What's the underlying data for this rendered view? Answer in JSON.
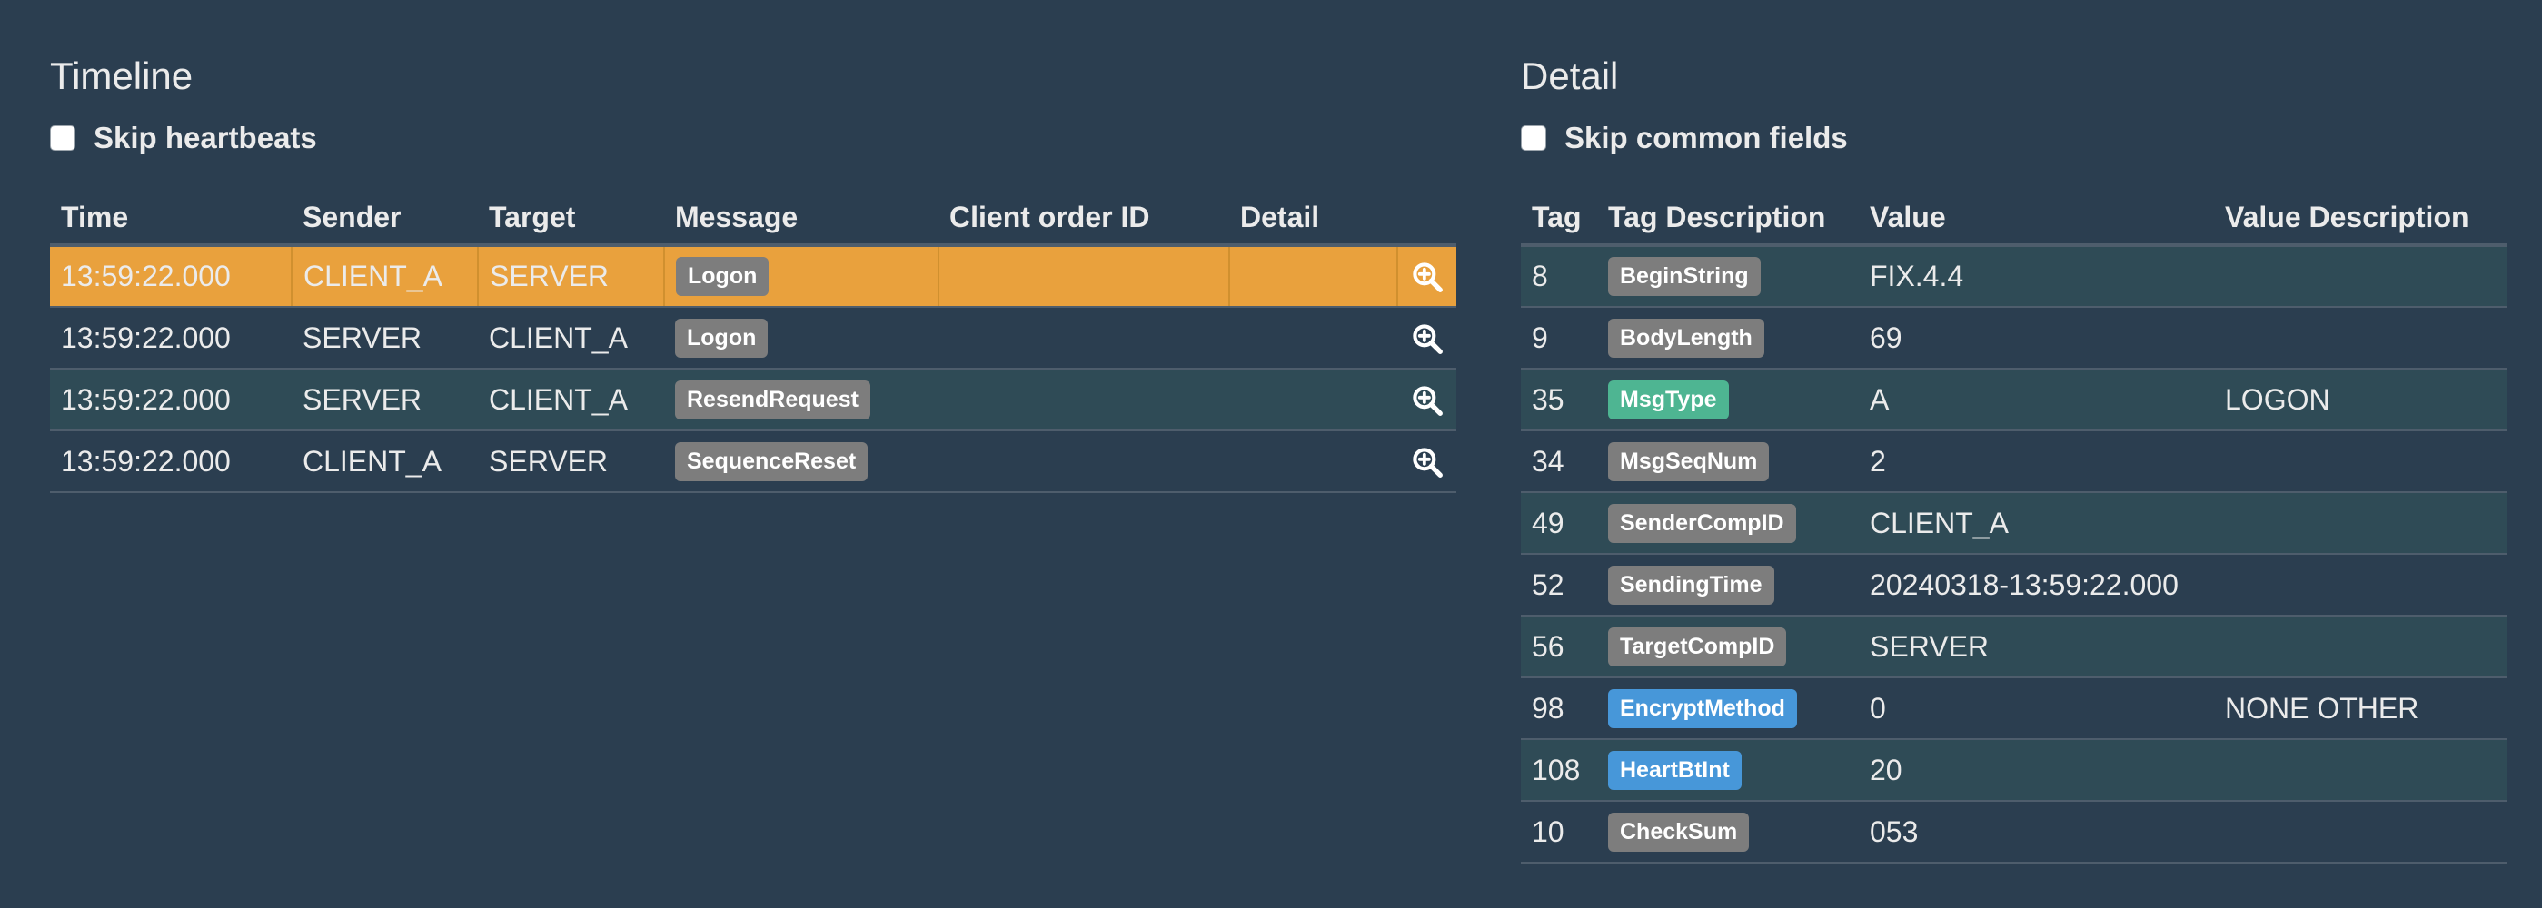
{
  "timeline": {
    "title": "Timeline",
    "skip_label": "Skip heartbeats",
    "columns": [
      "Time",
      "Sender",
      "Target",
      "Message",
      "Client order ID",
      "Detail"
    ],
    "rows": [
      {
        "time": "13:59:22.000",
        "sender": "CLIENT_A",
        "target": "SERVER",
        "message": "Logon",
        "client_order_id": "",
        "selected": true
      },
      {
        "time": "13:59:22.000",
        "sender": "SERVER",
        "target": "CLIENT_A",
        "message": "Logon",
        "client_order_id": ""
      },
      {
        "time": "13:59:22.000",
        "sender": "SERVER",
        "target": "CLIENT_A",
        "message": "ResendRequest",
        "client_order_id": ""
      },
      {
        "time": "13:59:22.000",
        "sender": "CLIENT_A",
        "target": "SERVER",
        "message": "SequenceReset",
        "client_order_id": ""
      }
    ],
    "detail_icon": "zoom-in-icon",
    "selected_color": "#e9a13d"
  },
  "detail": {
    "title": "Detail",
    "skip_label": "Skip common fields",
    "columns": [
      "Tag",
      "Tag Description",
      "Value",
      "Value Description"
    ],
    "rows": [
      {
        "tag": "8",
        "description": "BeginString",
        "style": "default",
        "value": "FIX.4.4",
        "value_description": ""
      },
      {
        "tag": "9",
        "description": "BodyLength",
        "style": "default",
        "value": "69",
        "value_description": ""
      },
      {
        "tag": "35",
        "description": "MsgType",
        "style": "success",
        "value": "A",
        "value_description": "LOGON"
      },
      {
        "tag": "34",
        "description": "MsgSeqNum",
        "style": "default",
        "value": "2",
        "value_description": ""
      },
      {
        "tag": "49",
        "description": "SenderCompID",
        "style": "default",
        "value": "CLIENT_A",
        "value_description": ""
      },
      {
        "tag": "52",
        "description": "SendingTime",
        "style": "default",
        "value": "20240318-13:59:22.000",
        "value_description": ""
      },
      {
        "tag": "56",
        "description": "TargetCompID",
        "style": "default",
        "value": "SERVER",
        "value_description": ""
      },
      {
        "tag": "98",
        "description": "EncryptMethod",
        "style": "info",
        "value": "0",
        "value_description": "NONE OTHER"
      },
      {
        "tag": "108",
        "description": "HeartBtInt",
        "style": "info",
        "value": "20",
        "value_description": ""
      },
      {
        "tag": "10",
        "description": "CheckSum",
        "style": "default",
        "value": "053",
        "value_description": ""
      }
    ]
  },
  "colors": {
    "background": "#2b3e50",
    "row_stripe": "#2f4b56",
    "label_default": "#7d7d7d",
    "label_info": "#4797d9",
    "label_success": "#4eb592"
  }
}
